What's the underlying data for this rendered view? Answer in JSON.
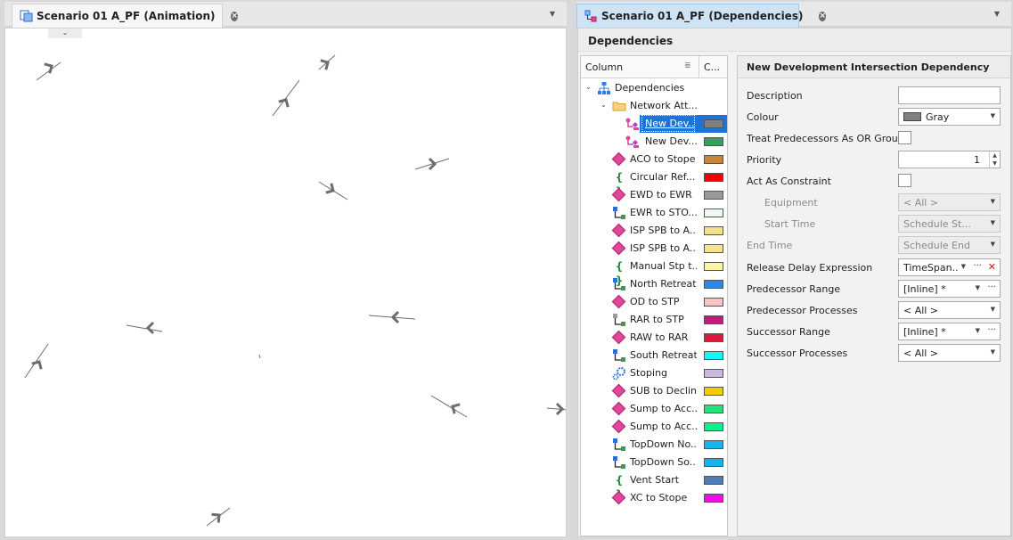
{
  "left_panel": {
    "tab_title": "Scenario 01 A_PF (Animation)"
  },
  "right_panel": {
    "tab_title": "Scenario 01 A_PF (Dependencies)",
    "panel_title": "Dependencies",
    "tree": {
      "column_header": "Column",
      "color_header": "C...",
      "rows": [
        {
          "label": "Dependencies",
          "icon": "hierarchy-icon",
          "level": 0,
          "expanded": true
        },
        {
          "label": "Network Att...",
          "icon": "folder-icon",
          "level": 1,
          "expanded": true
        },
        {
          "label": "New Dev...",
          "icon": "intersection-dependency-icon",
          "level": 2,
          "color": "#808080",
          "selected": true
        },
        {
          "label": "New Dev...",
          "icon": "intersection-dependency-icon",
          "level": 2,
          "color": "#3a9e5f"
        },
        {
          "label": "ACO to Stope",
          "icon": "diamond-icon",
          "level": 1,
          "color": "#c98537"
        },
        {
          "label": "Circular Ref...",
          "icon": "braces-icon",
          "level": 1,
          "color": "#f00000"
        },
        {
          "label": "EWD to EWR",
          "icon": "diamond-icon",
          "level": 1,
          "color": "#9a9a9a"
        },
        {
          "label": "EWR to STO...",
          "icon": "network-node-icon",
          "level": 1,
          "color": "#eefaee"
        },
        {
          "label": "ISP SPB to A...",
          "icon": "diamond-icon",
          "level": 1,
          "color": "#f2e28c"
        },
        {
          "label": "ISP SPB to A...",
          "icon": "diamond-icon",
          "level": 1,
          "color": "#f2e48f"
        },
        {
          "label": "Manual Stp t...",
          "icon": "braces-icon",
          "level": 1,
          "color": "#fbf6a2"
        },
        {
          "label": "North Retreat",
          "icon": "network-node-icon",
          "level": 1,
          "color": "#2a87e8"
        },
        {
          "label": "OD to STP",
          "icon": "diamond-icon",
          "level": 1,
          "color": "#f9c2c5"
        },
        {
          "label": "RAR to STP",
          "icon": "network-node-grey-icon",
          "level": 1,
          "color": "#c3197a"
        },
        {
          "label": "RAW to RAR",
          "icon": "diamond-icon",
          "level": 1,
          "color": "#d91a3d"
        },
        {
          "label": "South Retreat",
          "icon": "network-node-icon",
          "level": 1,
          "color": "#18f4f4"
        },
        {
          "label": "Stoping",
          "icon": "gear-flow-icon",
          "level": 1,
          "color": "#c9b7de"
        },
        {
          "label": "SUB to Decline",
          "icon": "diamond-icon",
          "level": 1,
          "color": "#f2cd00"
        },
        {
          "label": "Sump to Acc...",
          "icon": "diamond-icon",
          "level": 1,
          "color": "#26e27a"
        },
        {
          "label": "Sump to Acc...",
          "icon": "diamond-icon",
          "level": 1,
          "color": "#0df08c"
        },
        {
          "label": "TopDown No...",
          "icon": "network-node-icon",
          "level": 1,
          "color": "#19b4ee"
        },
        {
          "label": "TopDown So...",
          "icon": "network-node-icon",
          "level": 1,
          "color": "#14b6ea"
        },
        {
          "label": "Vent Start",
          "icon": "braces-icon",
          "level": 1,
          "color": "#4f7db8"
        },
        {
          "label": "XC to Stope",
          "icon": "diamond-icon",
          "level": 1,
          "color": "#f20ce8"
        }
      ]
    },
    "properties": {
      "title": "New Development Intersection Dependency",
      "rows": [
        {
          "label": "Description",
          "type": "text",
          "value": ""
        },
        {
          "label": "Colour",
          "type": "color-dropdown",
          "value": "Gray",
          "color": "#808080"
        },
        {
          "label": "Treat Predecessors As OR Group",
          "type": "checkbox"
        },
        {
          "label": "Priority",
          "type": "number",
          "value": "1"
        },
        {
          "label": "Act As Constraint",
          "type": "checkbox"
        },
        {
          "label": "Equipment",
          "type": "dropdown",
          "value": "< All >",
          "disabled": true,
          "indent": true
        },
        {
          "label": "Start Time",
          "type": "dropdown",
          "value": "Schedule St...",
          "disabled": true,
          "indent": true
        },
        {
          "label": "End Time",
          "type": "dropdown",
          "value": "Schedule End",
          "disabled": true
        },
        {
          "label": "Release Delay Expression",
          "type": "expression",
          "value": "TimeSpan..."
        },
        {
          "label": "Predecessor Range",
          "type": "range",
          "value": "[Inline] *"
        },
        {
          "label": "Predecessor Processes",
          "type": "dropdown",
          "value": "< All >"
        },
        {
          "label": "Successor Range",
          "type": "range",
          "value": "[Inline] *"
        },
        {
          "label": "Successor Processes",
          "type": "dropdown",
          "value": "< All >"
        }
      ]
    }
  }
}
